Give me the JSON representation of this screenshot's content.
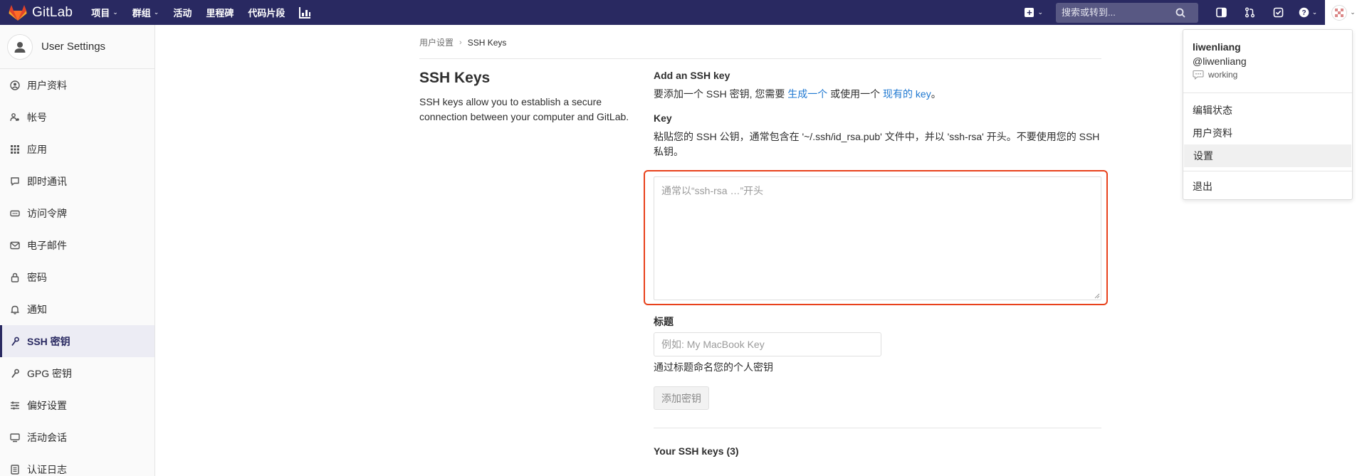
{
  "navbar": {
    "brand": "GitLab",
    "links": [
      {
        "label": "项目",
        "has_caret": true
      },
      {
        "label": "群组",
        "has_caret": true
      },
      {
        "label": "活动",
        "has_caret": false
      },
      {
        "label": "里程碑",
        "has_caret": false
      },
      {
        "label": "代码片段",
        "has_caret": false
      }
    ],
    "search_placeholder": "搜索或转到...",
    "caret": "⌄",
    "icons": [
      "chart-icon",
      "plus-square-icon",
      "search-icon",
      "sidebar-toggle-icon",
      "merge-request-icon",
      "todo-check-icon",
      "help-icon",
      "user-avatar"
    ]
  },
  "sidebar": {
    "title": "User Settings",
    "items": [
      {
        "label": "用户资料",
        "icon": "profile-icon"
      },
      {
        "label": "帐号",
        "icon": "account-icon"
      },
      {
        "label": "应用",
        "icon": "applications-icon"
      },
      {
        "label": "即时通讯",
        "icon": "chat-icon"
      },
      {
        "label": "访问令牌",
        "icon": "token-icon"
      },
      {
        "label": "电子邮件",
        "icon": "email-icon"
      },
      {
        "label": "密码",
        "icon": "lock-icon"
      },
      {
        "label": "通知",
        "icon": "bell-icon"
      },
      {
        "label": "SSH 密钥",
        "icon": "key-icon",
        "active": true
      },
      {
        "label": "GPG 密钥",
        "icon": "key-icon"
      },
      {
        "label": "偏好设置",
        "icon": "preferences-icon"
      },
      {
        "label": "活动会话",
        "icon": "monitor-icon"
      },
      {
        "label": "认证日志",
        "icon": "log-icon"
      }
    ]
  },
  "breadcrumb": {
    "parent": "用户设置",
    "separator": "›",
    "current": "SSH Keys"
  },
  "left": {
    "title": "SSH Keys",
    "description": "SSH keys allow you to establish a secure connection between your computer and GitLab."
  },
  "form": {
    "add_heading": "Add an SSH key",
    "add_intro": {
      "before": "要添加一个 SSH 密钥, 您需要 ",
      "link1": "生成一个",
      "middle": " 或使用一个 ",
      "link2": "现有的 key",
      "after": "。"
    },
    "key_label": "Key",
    "key_help": "粘贴您的 SSH 公钥，通常包含在 '~/.ssh/id_rsa.pub' 文件中，并以 'ssh-rsa' 开头。不要使用您的 SSH 私钥。",
    "key_placeholder": "通常以“ssh-rsa …”开头",
    "key_value": "",
    "title_label": "标题",
    "title_placeholder": "例如: My MacBook Key",
    "title_value": "",
    "title_help": "通过标题命名您的个人密钥",
    "submit_label": "添加密钥",
    "your_keys_heading": "Your SSH keys (3)"
  },
  "dropdown": {
    "name": "liwenliang",
    "handle": "@liwenliang",
    "status": "working",
    "items": [
      {
        "label": "编辑状态"
      },
      {
        "label": "用户资料"
      },
      {
        "label": "设置",
        "highlight": true
      }
    ],
    "signout": "退出"
  },
  "colors": {
    "navbar": "#292961",
    "link": "#1f78d1",
    "highlight_border": "#e8421c"
  }
}
